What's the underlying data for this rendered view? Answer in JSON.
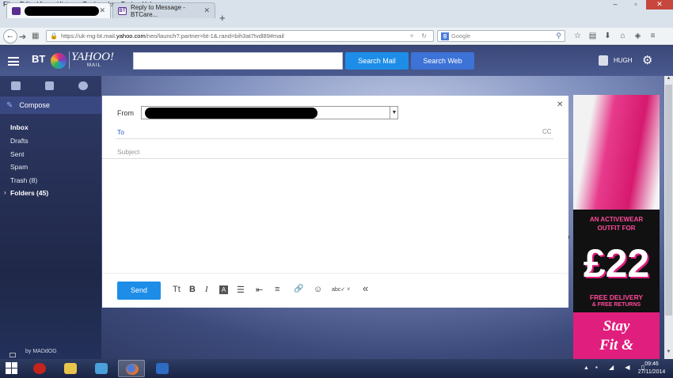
{
  "browser": {
    "menu": [
      "File",
      "Edit",
      "View",
      "History",
      "Bookmarks",
      "Tools",
      "Help"
    ],
    "window_controls": [
      "–",
      "▫",
      "✕"
    ],
    "tabs": [
      {
        "label": "",
        "redacted": true
      },
      {
        "label": "Reply to Message - BTCare...",
        "redacted": false
      }
    ],
    "url": {
      "prefix": "https://uk-mg-bt.mail.",
      "domain": "yahoo.com",
      "suffix": "/neo/launch?.partner=bt-1&.rand=bih3at7tvdl89#mail"
    },
    "search_placeholder": "Google",
    "search_badge": "g"
  },
  "header": {
    "brand_bt": "BT",
    "brand_yahoo": "YAHOO!",
    "brand_mail": "MAIL",
    "search_mail": "Search Mail",
    "search_web": "Search Web",
    "user_name": "HUGH"
  },
  "sidebar": {
    "compose": "Compose",
    "folders": [
      {
        "label": "Inbox",
        "bold": true
      },
      {
        "label": "Drafts",
        "bold": false
      },
      {
        "label": "Sent",
        "bold": false
      },
      {
        "label": "Spam",
        "bold": false
      },
      {
        "label": "Trash (8)",
        "bold": false
      },
      {
        "label": "Folders (45)",
        "bold": true
      }
    ],
    "footer": "by MADdOG"
  },
  "compose": {
    "from_label": "From",
    "to_label": "To",
    "cc_label": "CC",
    "subject_label": "Subject",
    "send": "Send",
    "format_tools": [
      "Tt",
      "B",
      "I",
      "A",
      "☰",
      "⇤",
      "≡",
      "🔗",
      "☺",
      "abc✓ ˅",
      "«"
    ]
  },
  "ad": {
    "line1": "AN ACTIVEWEAR",
    "line2": "OUTFIT FOR",
    "price": "£22",
    "line3": "FREE DELIVERY",
    "line4": "& FREE RETURNS",
    "slogan1": "Stay",
    "slogan2": "Fit &"
  },
  "taskbar": {
    "time": "09:46",
    "date": "27/11/2014"
  },
  "colors": {
    "accent_blue": "#1d8de8",
    "header_bg": "#3a4779",
    "ad_pink": "#e01e7d"
  }
}
